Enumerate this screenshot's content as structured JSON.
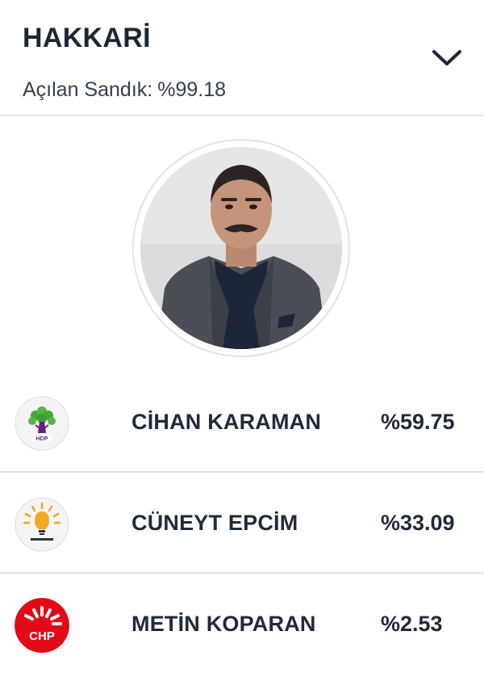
{
  "region": {
    "name": "HAKKARİ",
    "opened_label": "Açılan Sandık:",
    "opened_value": "%99.18"
  },
  "candidates": [
    {
      "party": "HDP",
      "name": "CİHAN KARAMAN",
      "percent": "%59.75",
      "logo": "hdp-logo",
      "color": "#6a1d7a"
    },
    {
      "party": "AK PARTİ",
      "name": "CÜNEYT EPCİM",
      "percent": "%33.09",
      "logo": "ak-parti-logo",
      "color": "#f5a623"
    },
    {
      "party": "CHP",
      "name": "METİN KOPARAN",
      "percent": "%2.53",
      "logo": "chp-logo",
      "color": "#e30a17"
    }
  ],
  "icons": {
    "toggle": "chevron-down-icon"
  },
  "colors": {
    "text": "#1f2a3a",
    "divider": "#e0e3e7"
  }
}
